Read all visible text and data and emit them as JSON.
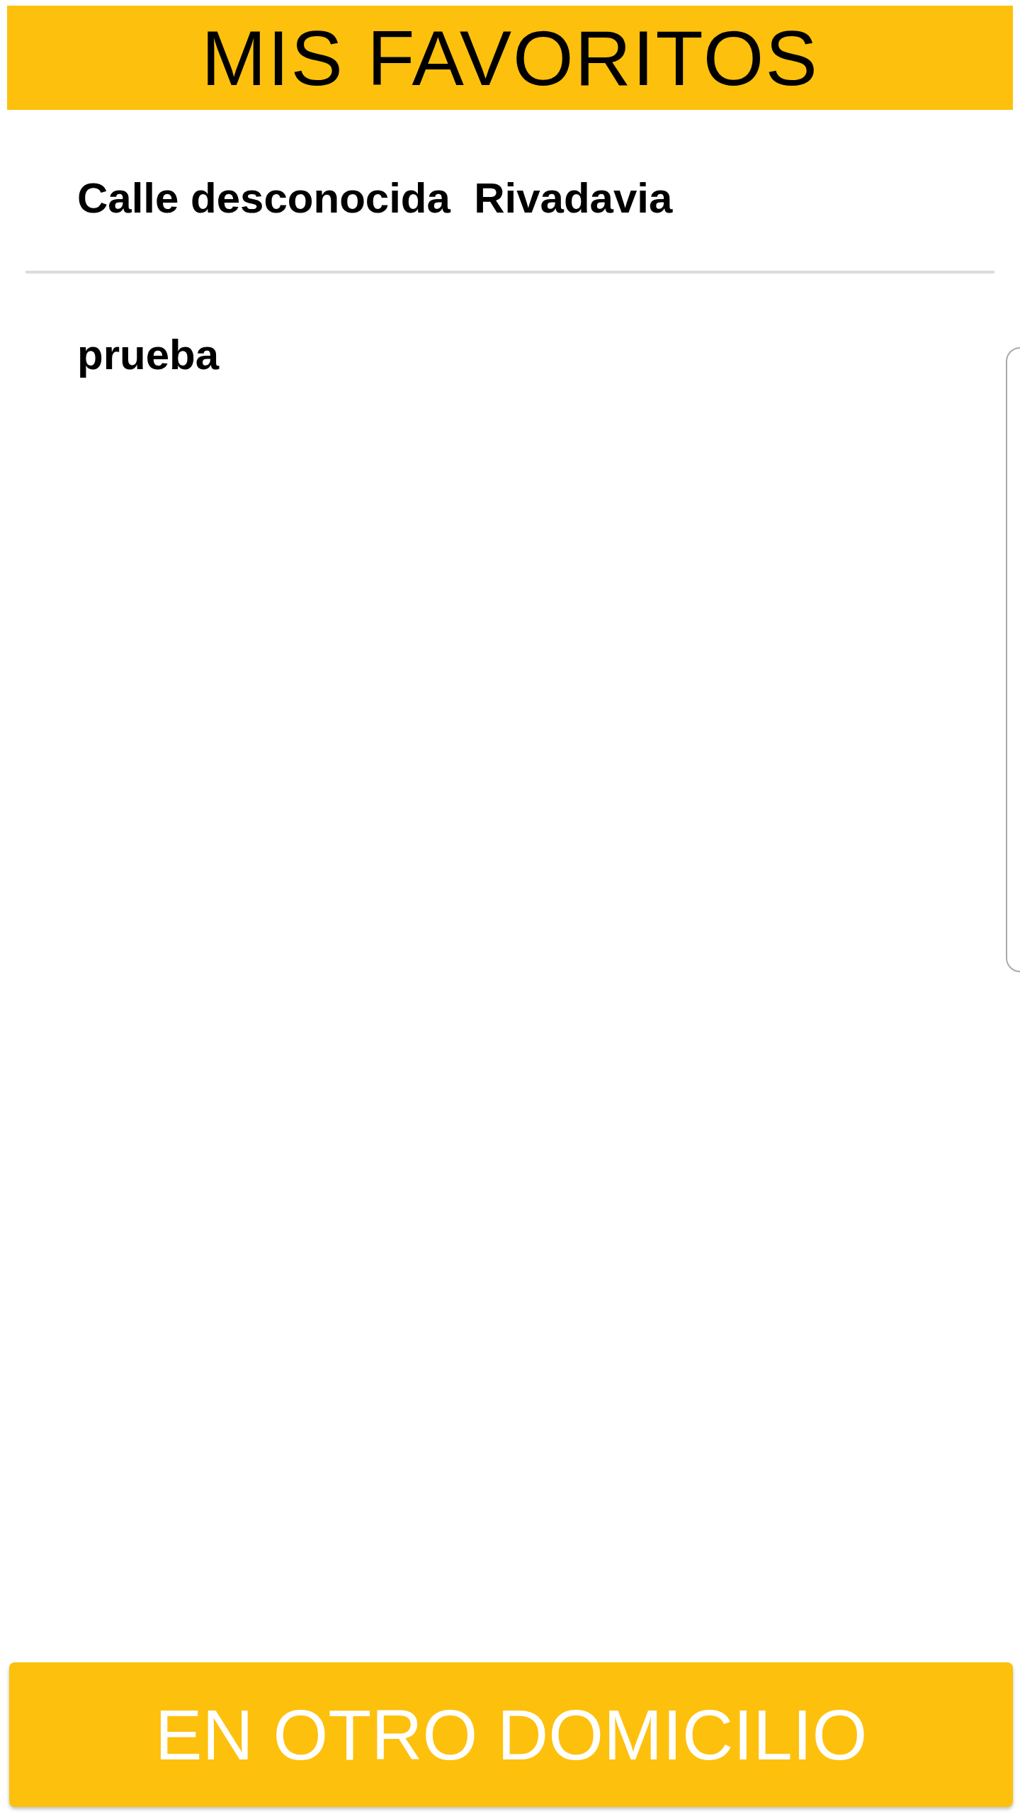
{
  "header": {
    "title": "MIS FAVORITOS"
  },
  "favorites": [
    {
      "label": "Calle desconocida  Rivadavia"
    },
    {
      "label": "prueba"
    }
  ],
  "action_button": {
    "label": "EN OTRO DOMICILIO"
  }
}
